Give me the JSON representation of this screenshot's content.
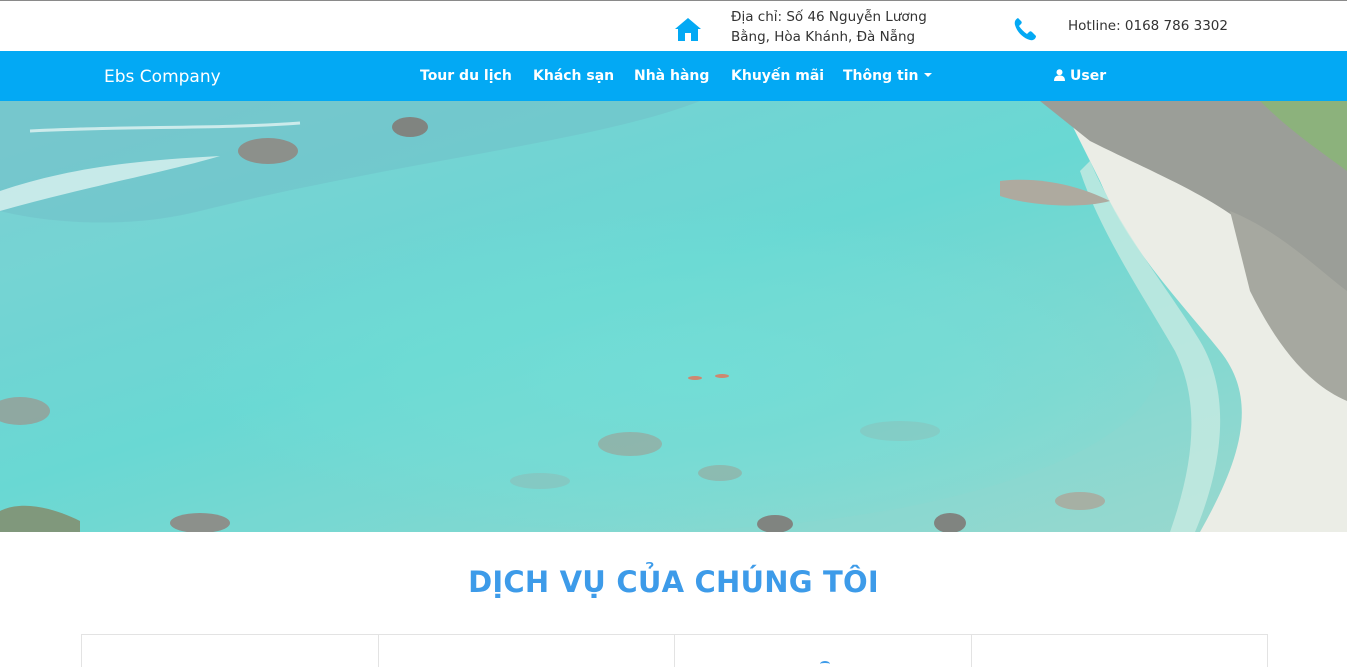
{
  "header": {
    "address_line1": "Địa chỉ: Số 46 Nguyễn Lương",
    "address_line2": "Bằng, Hòa Khánh, Đà Nẵng",
    "hotline": "Hotline: 0168 786 3302",
    "icons": [
      "home-icon",
      "phone-icon"
    ],
    "icon_color": "#03a9f4"
  },
  "navbar": {
    "brand": "Ebs Company",
    "background": "#03a9f4",
    "items": [
      {
        "label": "Tour du lịch"
      },
      {
        "label": "Khách sạn"
      },
      {
        "label": "Nhà hàng"
      },
      {
        "label": "Khuyến mãi"
      },
      {
        "label": "Thông tin",
        "dropdown": true
      }
    ],
    "user_label": "User"
  },
  "hero": {
    "image": "tropical beach with turquoise water and rocky shore"
  },
  "services": {
    "title": "DỊCH VỤ CỦA CHÚNG TÔI",
    "title_color": "#3d9be9",
    "card_count": 4
  }
}
